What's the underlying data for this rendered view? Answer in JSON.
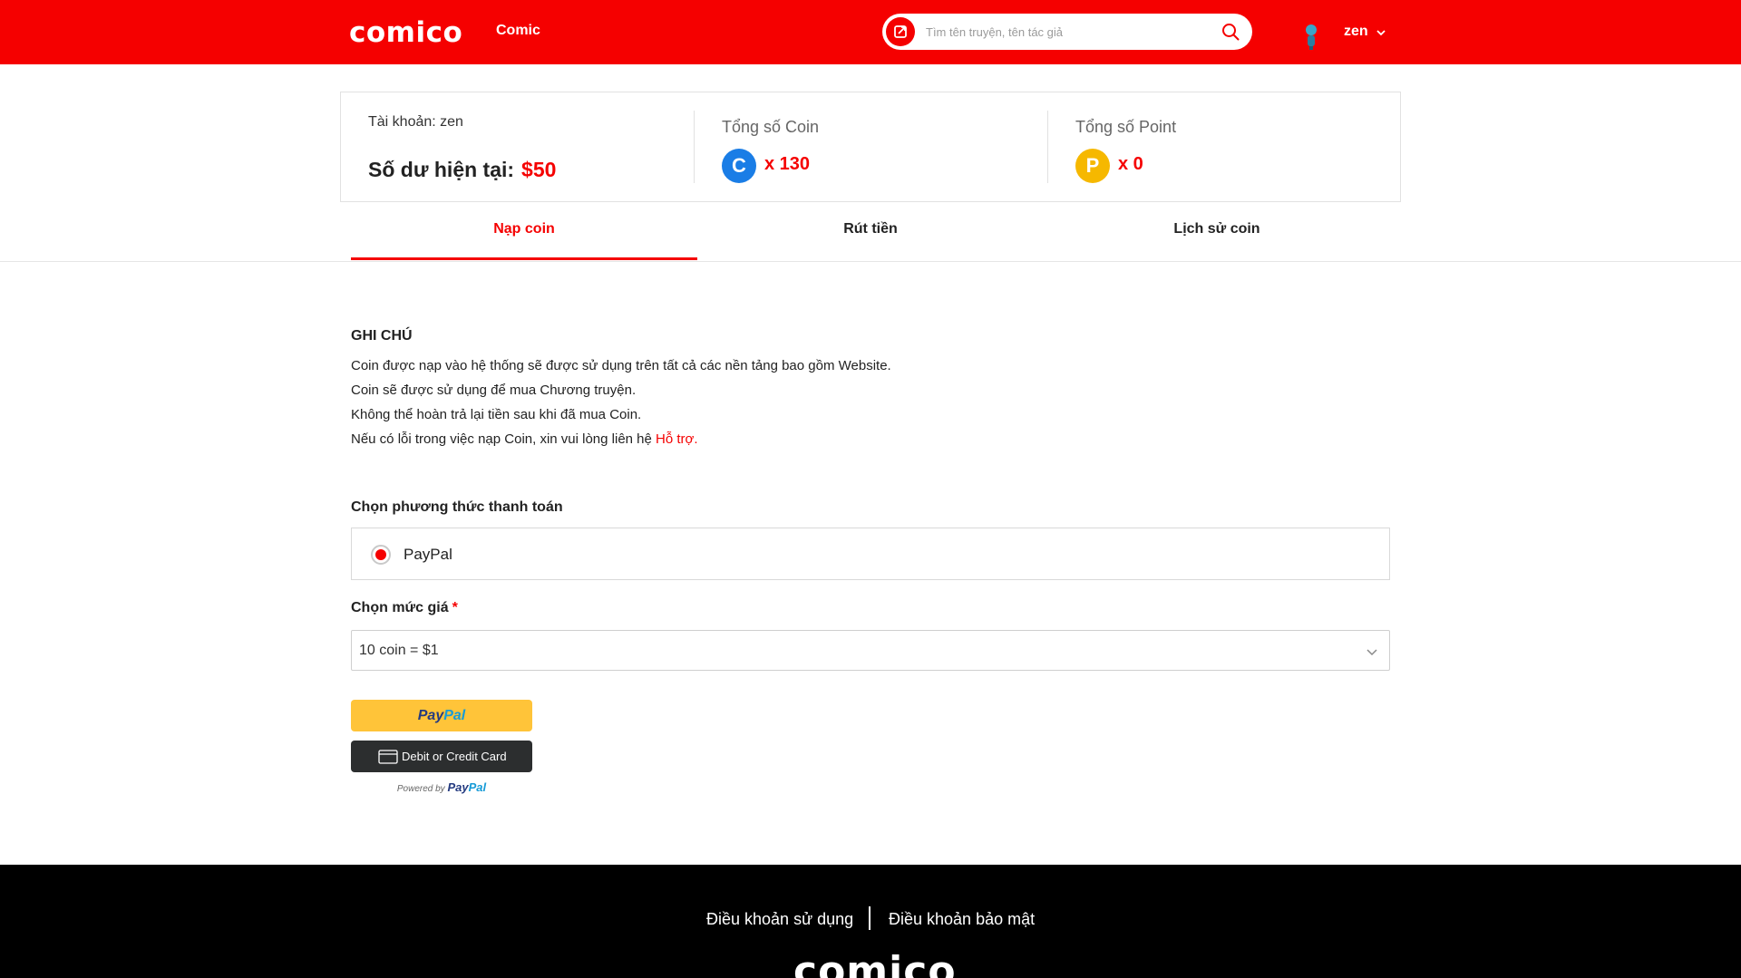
{
  "header": {
    "logo": "comico",
    "nav_comic": "Comic",
    "search_placeholder": "Tìm tên truyện, tên tác giả",
    "user_name": "zen"
  },
  "summary": {
    "account": "Tài khoản: zen",
    "balance_label": "Số dư hiện tại:",
    "balance_value": "$50",
    "coin_label": "Tổng số Coin",
    "coin_icon": "C",
    "coin_value": "x 130",
    "point_label": "Tổng số Point",
    "point_icon": "P",
    "point_value": "x 0"
  },
  "tabs": [
    {
      "label": "Nạp coin",
      "active": true
    },
    {
      "label": "Rút tiền",
      "active": false
    },
    {
      "label": "Lịch sử coin",
      "active": false
    }
  ],
  "notes": {
    "title": "GHI CHÚ",
    "lines": [
      "Coin được nạp vào hệ thống sẽ được sử dụng trên tất cả các nền tảng bao gồm Website.",
      "Coin sẽ được sử dụng để mua Chương truyện.",
      "Không thể hoàn trả lại tiền sau khi đã mua Coin.",
      "Nếu có lỗi trong việc nạp Coin, xin vui lòng liên hệ "
    ],
    "support_link": "Hỗ trợ."
  },
  "payment": {
    "label": "Chọn phương thức thanh toán",
    "method": "PayPal",
    "price_label": "Chọn mức giá",
    "required_mark": "*",
    "price_selected": "10 coin = $1",
    "paypal_pay": "Pay",
    "paypal_pal": "Pal",
    "card_button": "Debit or Credit Card",
    "powered_by": "Powered by",
    "powered_pay": "Pay",
    "powered_pal": "Pal"
  },
  "footer": {
    "terms": "Điều khoản sử dụng",
    "privacy": "Điều khoản bảo mật",
    "logo": "comico"
  },
  "colors": {
    "brand_red": "#f50000",
    "coin_blue": "#1a7de6",
    "point_yellow": "#f6b800",
    "paypal_yellow": "#ffc439"
  }
}
